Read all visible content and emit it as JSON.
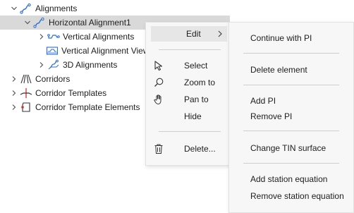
{
  "tree": {
    "items": [
      {
        "label": "Alignments",
        "icon": "alignment-icon",
        "expanded": true
      },
      {
        "label": "Horizontal Alignment1",
        "icon": "alignment-icon",
        "expanded": true,
        "selected": true
      },
      {
        "label": "Vertical Alignments",
        "icon": "vertical-alignment-icon",
        "expanded": false
      },
      {
        "label": "Vertical Alignment Views",
        "icon": "vertical-alignment-view-icon"
      },
      {
        "label": "3D Alignments",
        "icon": "3d-alignment-icon",
        "expanded": false
      },
      {
        "label": "Corridors",
        "icon": "corridor-icon",
        "expanded": false
      },
      {
        "label": "Corridor Templates",
        "icon": "corridor-template-icon",
        "expanded": false
      },
      {
        "label": "Corridor Template Elements",
        "icon": "corridor-template-element-icon",
        "expanded": false
      }
    ]
  },
  "context_menu": {
    "edit": "Edit",
    "select": "Select",
    "zoom_to": "Zoom to",
    "pan_to": "Pan to",
    "hide": "Hide",
    "delete": "Delete..."
  },
  "submenu": {
    "continue_with_pi": "Continue with PI",
    "delete_element": "Delete element",
    "add_pi": "Add PI",
    "remove_pi": "Remove PI",
    "change_tin_surface": "Change TIN surface",
    "add_station_equation": "Add station equation",
    "remove_station_equation": "Remove station equation"
  },
  "colors": {
    "icon_blue": "#2c6ed1",
    "icon_red": "#d93025",
    "selection": "#d9d9d9",
    "menu_bg": "#f7f7f7"
  }
}
